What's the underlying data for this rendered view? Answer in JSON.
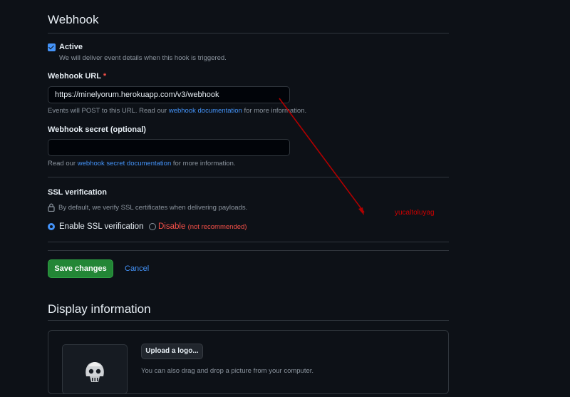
{
  "webhook": {
    "title": "Webhook",
    "active": {
      "label": "Active",
      "checked": true,
      "help": "We will deliver event details when this hook is triggered."
    },
    "url": {
      "label": "Webhook URL",
      "required_mark": "*",
      "value": "https://minelyorum.herokuapp.com/v3/webhook",
      "help_before": "Events will POST to this URL. Read our",
      "help_link": "webhook documentation",
      "help_after": "for more information."
    },
    "secret": {
      "label": "Webhook secret (optional)",
      "value": "",
      "help_before": "Read our",
      "help_link": "webhook secret documentation",
      "help_after": "for more information."
    },
    "ssl": {
      "title": "SSL verification",
      "help": "By default, we verify SSL certificates when delivering payloads.",
      "enable_label": "Enable SSL verification",
      "enable_selected": true,
      "disable_label": "Disable",
      "disable_note": "(not recommended)"
    }
  },
  "actions": {
    "save_label": "Save changes",
    "cancel_label": "Cancel"
  },
  "display": {
    "title": "Display information",
    "upload_label": "Upload a logo...",
    "upload_help": "You can also drag and drop a picture from your computer."
  },
  "annotation": {
    "text": "yucaltoluyag",
    "color": "#cc0000"
  },
  "colors": {
    "accent": "#4493f8",
    "save_green": "#238636",
    "danger": "#f85149",
    "background": "#0d1117"
  }
}
